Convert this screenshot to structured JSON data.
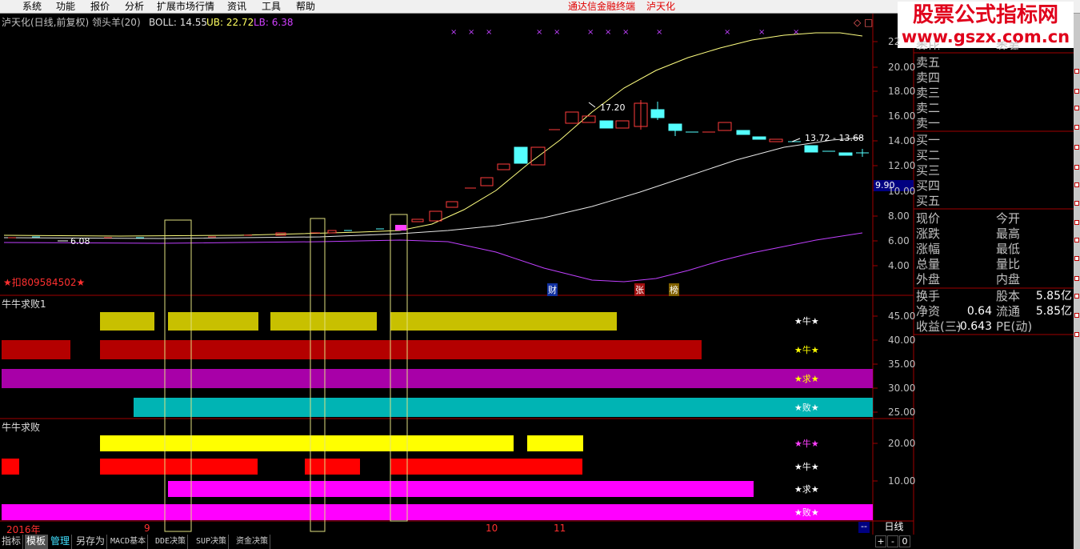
{
  "menu": [
    "系统",
    "功能",
    "报价",
    "分析",
    "扩展市场行情",
    "资讯",
    "工具",
    "帮助"
  ],
  "window_title": "通达信金融终端",
  "stock_name_title": "泸天化",
  "watermark": {
    "line1": "股票公式指标网",
    "line2": "www.gszx.com.cn"
  },
  "info": {
    "prefix": "泸天化(日线,前复权) 领头羊(20)",
    "boll": "BOLL: 14.55",
    "ub": "UB: 22.72",
    "lb": "LB: 6.38",
    "icon_diamond": "◇",
    "icon_box": "□"
  },
  "price_axis": [
    "22",
    "20.00",
    "18.00",
    "16.00",
    "14.00",
    "12.00",
    "10.00",
    "8.00",
    "6.00",
    "4.00"
  ],
  "price_tag": "9.90",
  "annotations": {
    "low": "6.08",
    "high": "17.20",
    "right": "13.72 - 13.68",
    "deduct": "★扣809584502★",
    "news1": "财",
    "news2": "张",
    "news3": "榜"
  },
  "panel1": {
    "title": "牛牛求败1",
    "axis": [
      "45.00",
      "40.00",
      "35.00",
      "30.00",
      "25.00"
    ],
    "labels": [
      "★牛★",
      "★牛★",
      "★求★",
      "★败★"
    ]
  },
  "panel2": {
    "title": "牛牛求败",
    "axis": [
      "20.00",
      "10.00"
    ],
    "labels": [
      "★牛★",
      "★牛★",
      "★求★",
      "★败★"
    ]
  },
  "date_axis": {
    "year": "2016年",
    "m9": "9",
    "m10": "10",
    "m11": "11"
  },
  "quote": {
    "sell_header_l": "委比",
    "sell_header_r": "委差",
    "sells": [
      "卖五",
      "卖四",
      "卖三",
      "卖二",
      "卖一"
    ],
    "buys": [
      "买一",
      "买二",
      "买三",
      "买四",
      "买五"
    ],
    "stats_left": [
      "现价",
      "涨跌",
      "涨幅",
      "总量",
      "外盘"
    ],
    "stats_right": [
      "今开",
      "最高",
      "最低",
      "量比",
      "内盘"
    ],
    "fin": [
      {
        "l": "换手",
        "v": "",
        "r": "股本",
        "rv": "5.85亿"
      },
      {
        "l": "净资",
        "v": "0.64",
        "r": "流通",
        "rv": "5.85亿"
      },
      {
        "l": "收益(三)",
        "v": "-0.643",
        "r": "PE(动)",
        "rv": ""
      }
    ]
  },
  "tabs": [
    "指标",
    "模板",
    "管理",
    "另存为",
    "MACD基本",
    "DDE决策",
    "SUP决策",
    "资金决策"
  ],
  "right_bottom": {
    "period": "日线",
    "nav": [
      "+",
      "-",
      "0"
    ],
    "dash": "--"
  },
  "colors": {
    "up": "#ff3c3c",
    "down": "#54ffff",
    "yellow": "#c8c000",
    "darkred": "#b40000",
    "purple": "#a800a8",
    "cyan": "#00b4b4",
    "brightyellow": "#ffff00",
    "red": "#ff0000",
    "magenta": "#ff00ff"
  }
}
